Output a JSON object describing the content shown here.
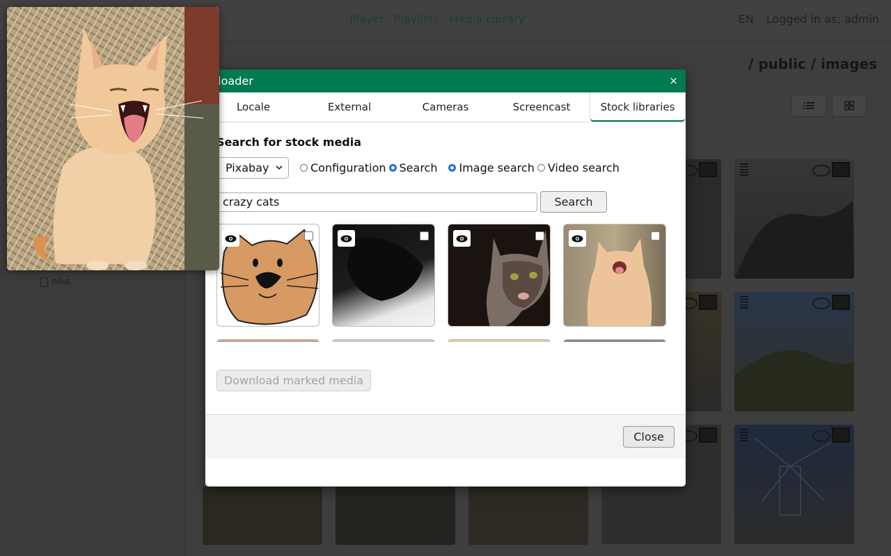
{
  "nav": {
    "items": [
      "Player",
      "Playlists",
      "Media Library"
    ],
    "language": "EN",
    "user": "Logged in as: admin"
  },
  "sidebar": {
    "tree_item": "niko"
  },
  "content": {
    "breadcrumb": "/ public / images"
  },
  "modal": {
    "title": "ploader",
    "close_x": "×",
    "tabs": [
      "Locale",
      "External",
      "Cameras",
      "Screencast",
      "Stock libraries"
    ],
    "active_tab": "Stock libraries",
    "section_title": "Search for stock media",
    "provider": "Pixabay",
    "mode_radios": [
      {
        "label": "Configuration",
        "checked": false
      },
      {
        "label": "Search",
        "checked": true
      }
    ],
    "type_radios": [
      {
        "label": "Image search",
        "checked": true
      },
      {
        "label": "Video search",
        "checked": false
      }
    ],
    "query": "crazy cats",
    "search_button": "Search",
    "download_button": "Download marked media",
    "close_button": "Close"
  },
  "colors": {
    "accent": "#017a4f",
    "radio": "#1a73e8",
    "overlay": "#3d3d3d"
  },
  "icons": [
    "eye-icon",
    "image-icon",
    "drag-handle-icon",
    "list-view-icon",
    "grid-view-icon",
    "file-icon",
    "chevron-down-icon",
    "close-icon"
  ]
}
